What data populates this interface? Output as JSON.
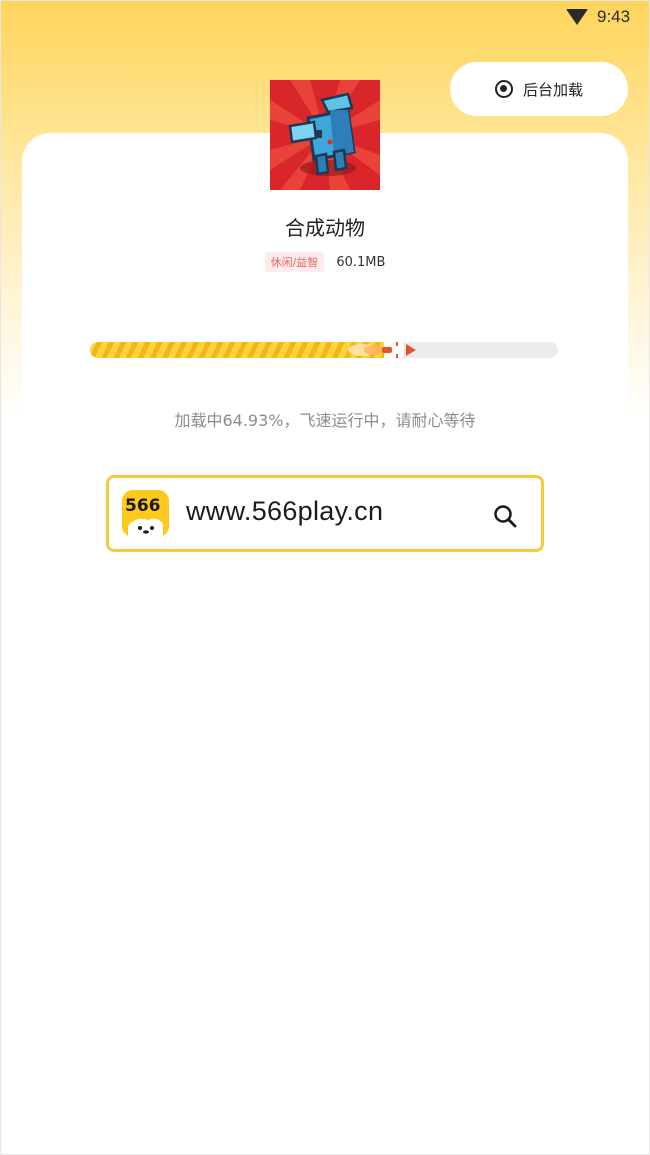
{
  "status_bar": {
    "time": "9:43",
    "wifi_icon": "wifi-icon"
  },
  "background_load": {
    "label": "后台加载",
    "icon": "target-icon"
  },
  "game": {
    "title": "合成动物",
    "category": "休闲/益智",
    "size": "60.1MB",
    "icon": "game-app-icon"
  },
  "progress": {
    "percent": 64.93,
    "status_text": "加载中64.93%，飞速运行中，请耐心等待",
    "colors": {
      "fill": "#ffd43b",
      "fill_stripe": "#f2b51c",
      "track": "#ececec",
      "flame": "#e8532b"
    }
  },
  "search": {
    "url": "www.566play.cn",
    "logo_text": "566",
    "icon": "search-icon",
    "border_color": "#f7cc3a"
  },
  "colors": {
    "accent": "#ffd45a",
    "tag_text": "#e8665f",
    "tag_bg": "#fdeceb"
  }
}
